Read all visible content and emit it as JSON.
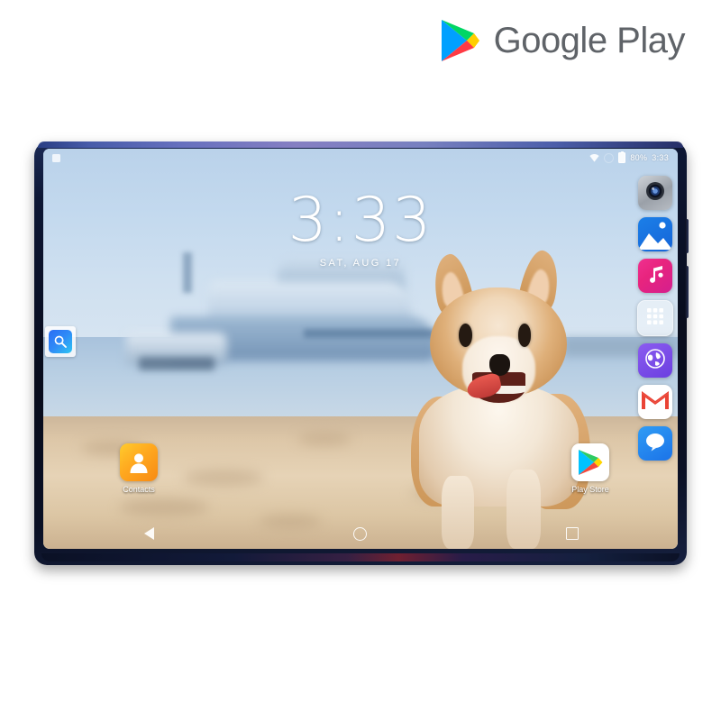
{
  "brand": {
    "name": "Google Play",
    "logo_icon": "google-play-logo",
    "colors": {
      "blue": "#00a0ff",
      "green": "#00d664",
      "yellow": "#ffce00",
      "red": "#ff3a44",
      "text": "#5f6368"
    }
  },
  "device": {
    "type": "android-tablet",
    "frame_color": "#0d1734",
    "edge_highlight": "#6a74c4"
  },
  "statusbar": {
    "left_icons": [
      "notification-icon"
    ],
    "right_icons": [
      "wifi-icon",
      "sync-icon",
      "battery-icon"
    ],
    "battery_level": "80%",
    "time": "3:33"
  },
  "clock_widget": {
    "time": "3:33",
    "date": "SAT, AUG 17"
  },
  "search_widget": {
    "icon": "search-icon",
    "label": "Search"
  },
  "dock": {
    "position": "right",
    "items": [
      {
        "name": "camera",
        "icon": "camera-icon",
        "label": "Camera"
      },
      {
        "name": "gallery",
        "icon": "gallery-icon",
        "label": "Gallery"
      },
      {
        "name": "music",
        "icon": "music-icon",
        "label": "Music"
      },
      {
        "name": "app-drawer",
        "icon": "app-drawer-icon",
        "label": "Apps"
      },
      {
        "name": "browser",
        "icon": "globe-icon",
        "label": "Browser"
      },
      {
        "name": "gmail",
        "icon": "gmail-icon",
        "label": "Gmail"
      },
      {
        "name": "messages",
        "icon": "messages-icon",
        "label": "Messages"
      }
    ]
  },
  "home_apps": [
    {
      "name": "contacts",
      "icon": "contacts-icon",
      "label": "Contacts"
    },
    {
      "name": "play-store",
      "icon": "play-store-icon",
      "label": "Play Store"
    }
  ],
  "navbar": {
    "back": "back-icon",
    "home": "home-icon",
    "recents": "recents-icon"
  },
  "wallpaper": {
    "description": "Beach harbour with blurred yacht and a corgi dog on sand"
  }
}
